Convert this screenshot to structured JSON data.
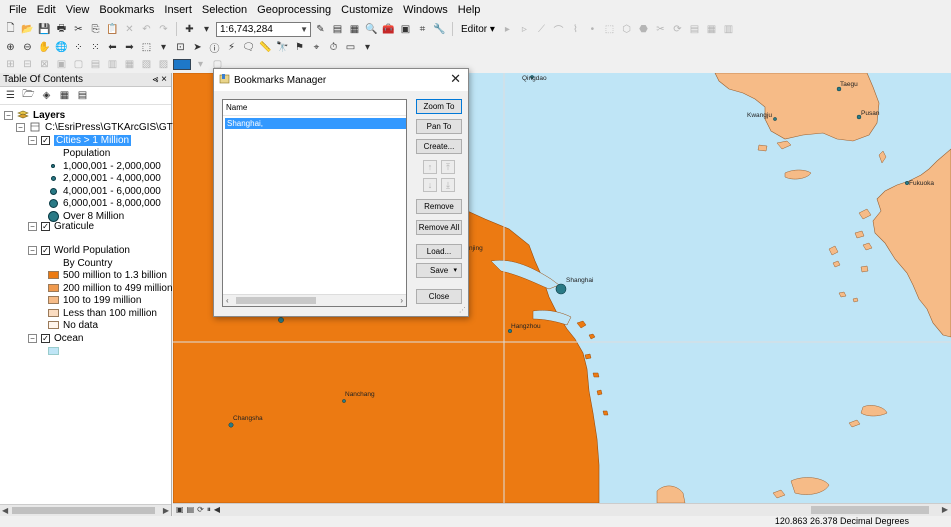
{
  "menu": [
    "File",
    "Edit",
    "View",
    "Bookmarks",
    "Insert",
    "Selection",
    "Geoprocessing",
    "Customize",
    "Windows",
    "Help"
  ],
  "toolbar": {
    "scale_value": "1:6,743,284",
    "editor_label": "Editor"
  },
  "toc": {
    "title": "Table Of Contents",
    "dock_controls": "⪡ ×",
    "layers_label": "Layers",
    "path": "C:\\EsriPress\\GTKArcGIS\\GTKArcGIS\\Cha",
    "cities_layer": "Cities > 1 Million",
    "population_heading": "Population",
    "population_classes": [
      "1,000,001 - 2,000,000",
      "2,000,001 - 4,000,000",
      "4,000,001 - 6,000,000",
      "6,000,001 - 8,000,000",
      "Over 8 Million"
    ],
    "graticule_layer": "Graticule",
    "world_population_layer": "World Population",
    "by_country_heading": "By Country",
    "country_classes": [
      "500 million to 1.3 billion",
      "200 million to 499 million",
      "100 to 199 million",
      "Less than 100 million",
      "No data"
    ],
    "ocean_layer": "Ocean"
  },
  "map": {
    "labels": {
      "qingdao": "Qingdao",
      "taegu": "Taegu",
      "kwangju": "Kwangju",
      "pusan": "Pusan",
      "fukuoka": "Fukuoka",
      "nanjing": "njing",
      "shanghai": "Shanghai",
      "hangzhou": "Hangzhou",
      "nanchang": "Nanchang",
      "changsha": "Changsha"
    }
  },
  "dialog": {
    "title": "Bookmarks Manager",
    "list_header": "Name",
    "bookmarks": [
      "Shanghai,"
    ],
    "buttons": {
      "zoom_to": "Zoom To",
      "pan_to": "Pan To",
      "create": "Create...",
      "remove": "Remove",
      "remove_all": "Remove All",
      "load": "Load...",
      "save": "Save",
      "close": "Close"
    }
  },
  "status": {
    "coordinates": "120.863  26.378 Decimal Degrees"
  },
  "colors": {
    "china": "#ec7a12",
    "highlight_land": "#f6bb87",
    "ocean": "#bfe5f6",
    "selection": "#3399ff",
    "city_symbol": "#2a7a86"
  }
}
